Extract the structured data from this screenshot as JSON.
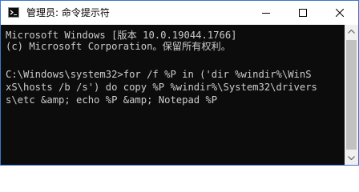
{
  "window": {
    "title": "管理员: 命令提示符",
    "controls": {
      "minimize_icon": "minimize-icon",
      "maximize_icon": "maximize-icon",
      "close_icon": "close-icon"
    }
  },
  "console": {
    "lines": [
      "Microsoft Windows [版本 10.0.19044.1766]",
      "(c) Microsoft Corporation。保留所有权利。",
      "",
      "C:\\Windows\\system32>for /f %P in ('dir %windir%\\WinS",
      "xS\\hosts /b /s') do copy %P %windir%\\System32\\drivers",
      "s\\etc &amp; echo %P &amp; Notepad %P"
    ],
    "foreground": "#cccccc",
    "background": "#0c0c0c"
  }
}
